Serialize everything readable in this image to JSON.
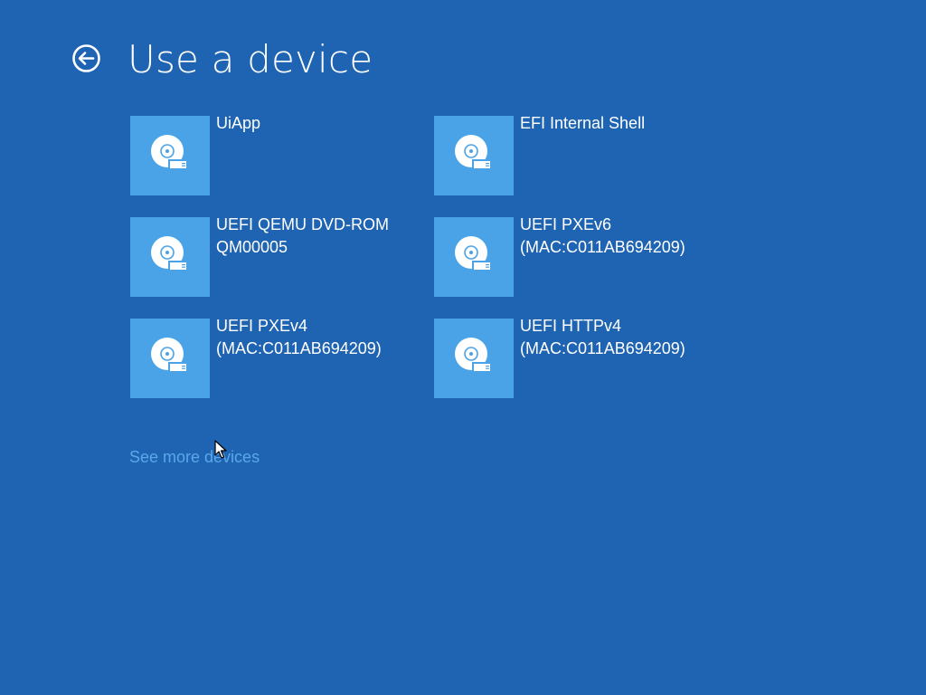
{
  "header": {
    "title": "Use a device",
    "back_icon": "back-arrow-circle-icon"
  },
  "devices": [
    {
      "label": "UiApp",
      "icon": "disk-drive-icon"
    },
    {
      "label": "EFI Internal Shell",
      "icon": "disk-drive-icon"
    },
    {
      "label": "UEFI QEMU DVD-ROM QM00005",
      "icon": "disk-drive-icon"
    },
    {
      "label": "UEFI PXEv6 (MAC:C011AB694209)",
      "icon": "disk-drive-icon"
    },
    {
      "label": "UEFI PXEv4 (MAC:C011AB694209)",
      "icon": "disk-drive-icon"
    },
    {
      "label": "UEFI HTTPv4 (MAC:C011AB694209)",
      "icon": "disk-drive-icon"
    }
  ],
  "footer": {
    "see_more": "See more devices"
  },
  "colors": {
    "background": "#1f64b2",
    "tile": "#4aa3e6",
    "link": "#5aa8e8",
    "text": "#ffffff"
  }
}
